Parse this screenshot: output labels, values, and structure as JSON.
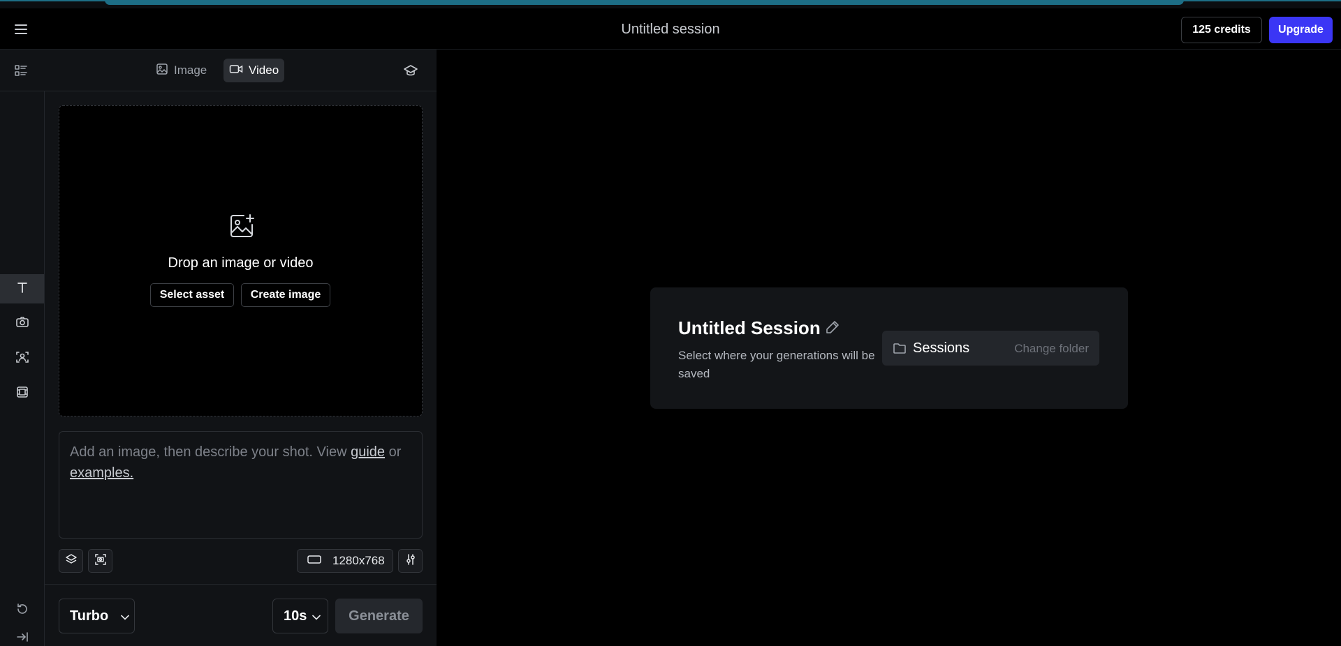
{
  "header": {
    "session_title": "Untitled session",
    "credits": "125 credits",
    "upgrade_label": "Upgrade"
  },
  "mode_tabs": [
    {
      "label": "Image",
      "icon": "image-icon",
      "active": false
    },
    {
      "label": "Video",
      "icon": "video-camera-icon",
      "active": true
    }
  ],
  "rail": {
    "items": [
      {
        "icon": "text-icon",
        "active": true
      },
      {
        "icon": "camera-icon",
        "active": false
      },
      {
        "icon": "face-scan-icon",
        "active": false
      },
      {
        "icon": "frames-icon",
        "active": false
      }
    ],
    "bottom": [
      "history-icon",
      "collapse-icon"
    ]
  },
  "dropzone": {
    "text": "Drop an image or video",
    "select_asset": "Select asset",
    "create_image": "Create image"
  },
  "prompt": {
    "text_before": "Add an image, then describe your shot. View ",
    "guide_link": "guide",
    "text_middle": " or ",
    "examples_link": "examples."
  },
  "toolbar": {
    "resolution": "1280x768"
  },
  "footer": {
    "model": "Turbo",
    "duration": "10s",
    "generate_label": "Generate"
  },
  "card": {
    "title": "Untitled Session",
    "description": "Select where your generations will be saved",
    "folder_name": "Sessions",
    "change_folder": "Change folder"
  },
  "colors": {
    "accent": "#3b36f5",
    "sidebar_bg": "#111316",
    "main_bg": "#000000",
    "card_bg": "#131518"
  }
}
